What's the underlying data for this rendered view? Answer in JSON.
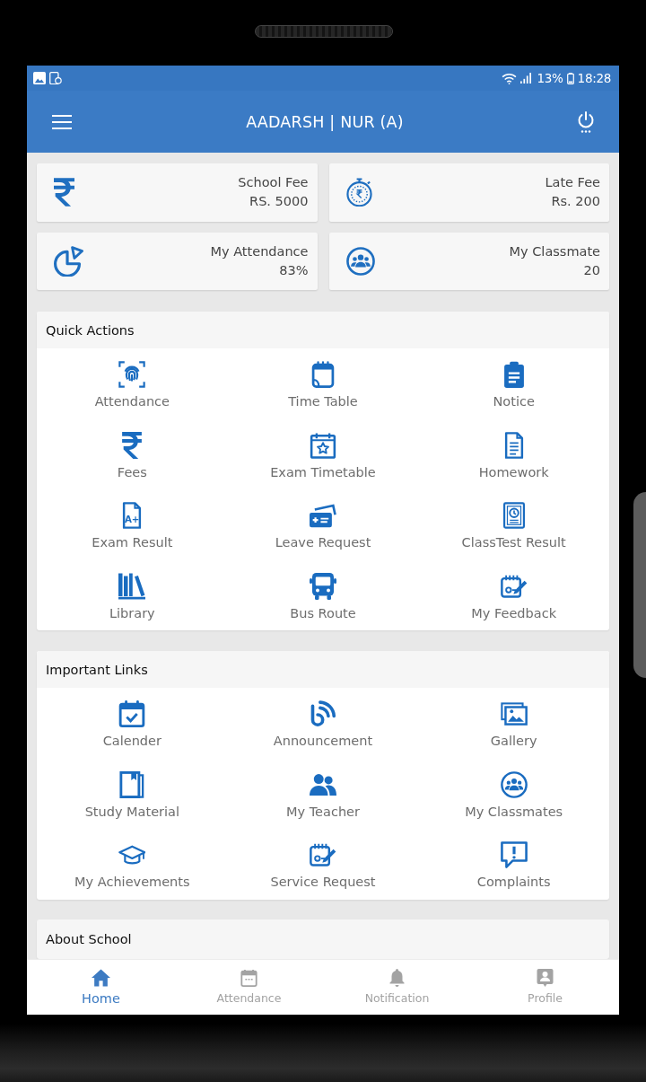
{
  "status_bar": {
    "battery": "13%",
    "time": "18:28"
  },
  "app_bar": {
    "title": "AADARSH | NUR (A)"
  },
  "stat_cards": [
    {
      "label": "School Fee",
      "value": "RS. 5000"
    },
    {
      "label": "Late Fee",
      "value": "Rs. 200"
    },
    {
      "label": "My Attendance",
      "value": "83%"
    },
    {
      "label": "My Classmate",
      "value": "20"
    }
  ],
  "sections": [
    {
      "title": "Quick Actions",
      "items": [
        {
          "label": "Attendance"
        },
        {
          "label": "Time Table"
        },
        {
          "label": "Notice"
        },
        {
          "label": "Fees"
        },
        {
          "label": "Exam Timetable"
        },
        {
          "label": "Homework"
        },
        {
          "label": "Exam Result",
          "icon_text": "A+"
        },
        {
          "label": "Leave Request"
        },
        {
          "label": "ClassTest Result"
        },
        {
          "label": "Library"
        },
        {
          "label": "Bus Route"
        },
        {
          "label": "My Feedback"
        }
      ]
    },
    {
      "title": "Important Links",
      "items": [
        {
          "label": "Calender"
        },
        {
          "label": "Announcement"
        },
        {
          "label": "Gallery"
        },
        {
          "label": "Study Material"
        },
        {
          "label": "My Teacher"
        },
        {
          "label": "My Classmates"
        },
        {
          "label": "My Achievements"
        },
        {
          "label": "Service Request"
        },
        {
          "label": "Complaints"
        }
      ]
    },
    {
      "title": "About School"
    }
  ],
  "bottom_nav": [
    {
      "label": "Home",
      "selected": true
    },
    {
      "label": "Attendance",
      "selected": false
    },
    {
      "label": "Notification",
      "selected": false
    },
    {
      "label": "Profile",
      "selected": false
    }
  ]
}
